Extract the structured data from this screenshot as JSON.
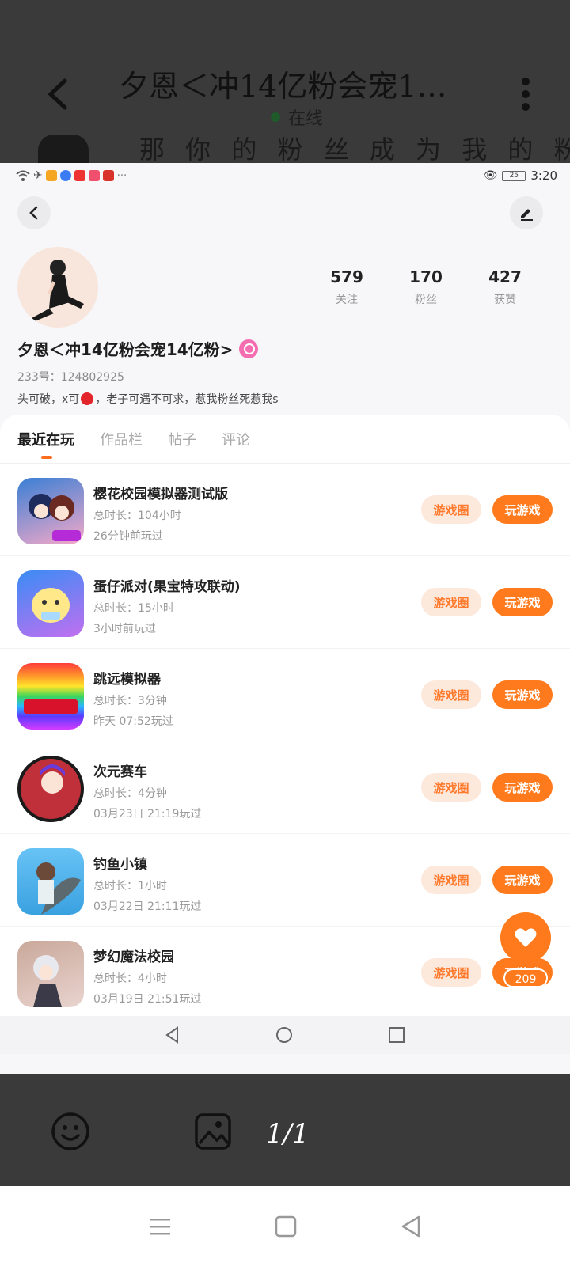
{
  "viewer": {
    "title": "夕恩＜冲14亿粉会宠1…",
    "status": "在线",
    "marquee": "那 你 的 粉 丝 成 为 我 的 粉",
    "page_counter": "1/1"
  },
  "screenshot": {
    "status_bar": {
      "time": "3:20",
      "battery": "25"
    },
    "profile": {
      "name": "夕恩＜冲14亿粉会宠14亿粉>",
      "uid": "233号：124802925",
      "bio_before": "头可破，x可",
      "bio_after": "，老子可遇不可求，惹我粉丝死惹我s",
      "stats": [
        {
          "value": "579",
          "label": "关注"
        },
        {
          "value": "170",
          "label": "粉丝"
        },
        {
          "value": "427",
          "label": "获赞"
        }
      ]
    },
    "tabs": [
      "最近在玩",
      "作品栏",
      "帖子",
      "评论"
    ],
    "buttons": {
      "circle": "游戏圈",
      "play": "玩游戏"
    },
    "games": [
      {
        "name": "樱花校园模拟器测试版",
        "duration": "总时长：104小时",
        "last_played": "26分钟前玩过"
      },
      {
        "name": "蛋仔派对(果宝特攻联动)",
        "duration": "总时长：15小时",
        "last_played": "3小时前玩过"
      },
      {
        "name": "跳远模拟器",
        "duration": "总时长：3分钟",
        "last_played": "昨天 07:52玩过"
      },
      {
        "name": "次元赛车",
        "duration": "总时长：4分钟",
        "last_played": "03月23日 21:19玩过"
      },
      {
        "name": "钓鱼小镇",
        "duration": "总时长：1小时",
        "last_played": "03月22日 21:11玩过"
      },
      {
        "name": "梦幻魔法校园",
        "duration": "总时长：4小时",
        "last_played": "03月19日 21:51玩过"
      }
    ],
    "like_count": "209"
  },
  "colors": {
    "accent": "#ff7a1c",
    "accent_soft": "#fde8dc"
  }
}
